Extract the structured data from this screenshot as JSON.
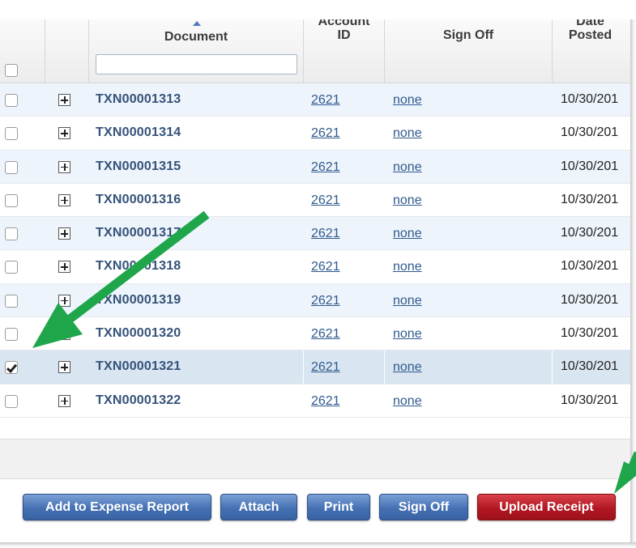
{
  "header": {
    "columns": {
      "document": "Document",
      "account_id": "Account\nID",
      "sign_off": "Sign Off",
      "date_posted": "Date\nPosted"
    },
    "document_filter_value": ""
  },
  "rows": [
    {
      "document": "TXN00001313",
      "account_id": "2621",
      "sign_off": "none",
      "date": "10/30/201",
      "checked": false
    },
    {
      "document": "TXN00001314",
      "account_id": "2621",
      "sign_off": "none",
      "date": "10/30/201",
      "checked": false
    },
    {
      "document": "TXN00001315",
      "account_id": "2621",
      "sign_off": "none",
      "date": "10/30/201",
      "checked": false
    },
    {
      "document": "TXN00001316",
      "account_id": "2621",
      "sign_off": "none",
      "date": "10/30/201",
      "checked": false
    },
    {
      "document": "TXN00001317",
      "account_id": "2621",
      "sign_off": "none",
      "date": "10/30/201",
      "checked": false
    },
    {
      "document": "TXN00001318",
      "account_id": "2621",
      "sign_off": "none",
      "date": "10/30/201",
      "checked": false
    },
    {
      "document": "TXN00001319",
      "account_id": "2621",
      "sign_off": "none",
      "date": "10/30/201",
      "checked": false
    },
    {
      "document": "TXN00001320",
      "account_id": "2621",
      "sign_off": "none",
      "date": "10/30/201",
      "checked": false
    },
    {
      "document": "TXN00001321",
      "account_id": "2621",
      "sign_off": "none",
      "date": "10/30/201",
      "checked": true
    },
    {
      "document": "TXN00001322",
      "account_id": "2621",
      "sign_off": "none",
      "date": "10/30/201",
      "checked": false
    }
  ],
  "buttons": {
    "add_to_expense_report": "Add to Expense Report",
    "attach": "Attach",
    "print": "Print",
    "sign_off": "Sign Off",
    "upload_receipt": "Upload Receipt"
  },
  "colors": {
    "annotation_arrow": "#1fa64a",
    "primary_button": "#4470b2",
    "danger_button": "#b11722",
    "link": "#2f5a8e"
  }
}
